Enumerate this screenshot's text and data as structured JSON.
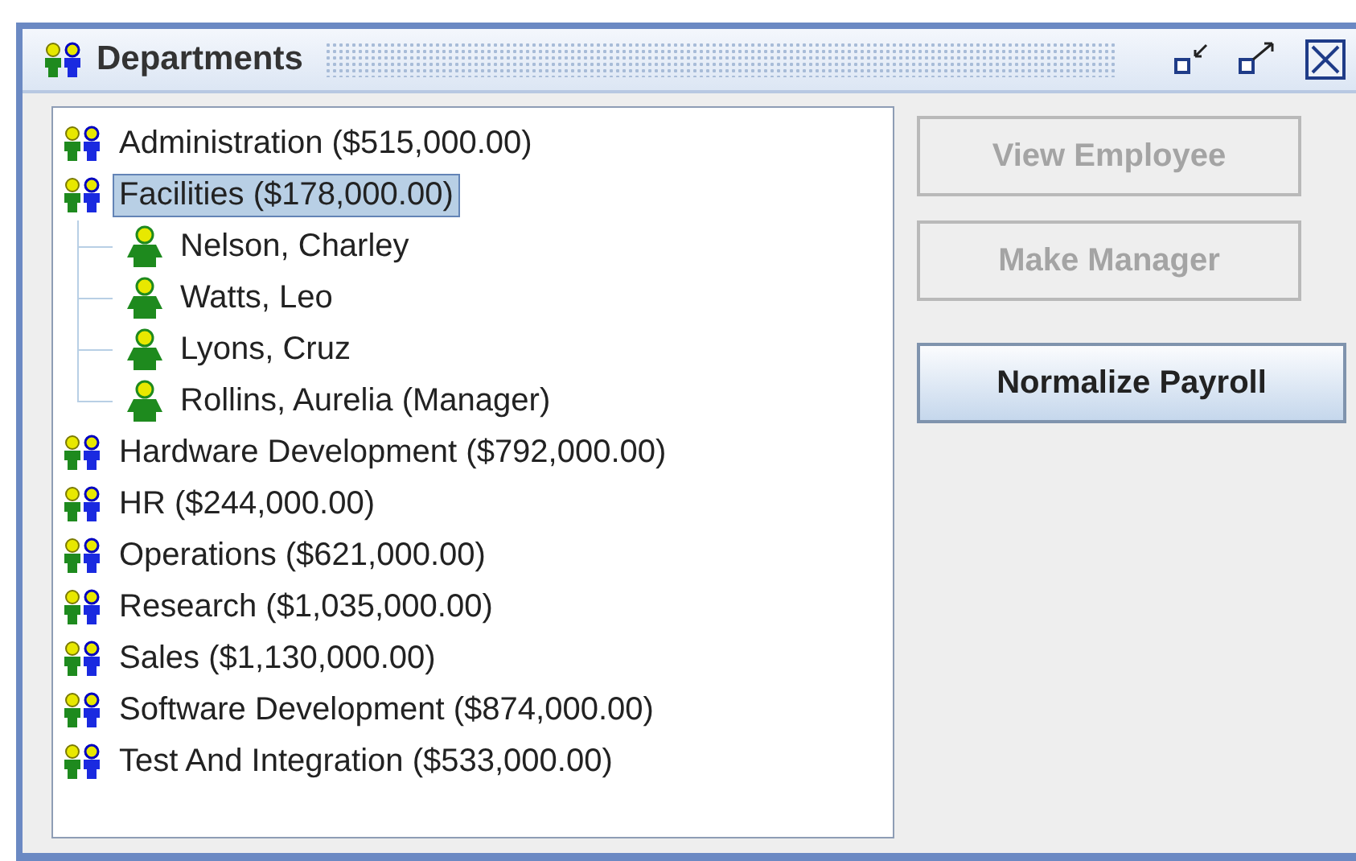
{
  "window": {
    "title": "Departments"
  },
  "tree": [
    {
      "label": "Administration ($515,000.00)",
      "kind": "department",
      "selected": false
    },
    {
      "label": "Facilities ($178,000.00)",
      "kind": "department",
      "selected": true,
      "children": [
        {
          "label": "Nelson, Charley",
          "kind": "employee",
          "selected": false
        },
        {
          "label": "Watts, Leo",
          "kind": "employee",
          "selected": false
        },
        {
          "label": "Lyons, Cruz",
          "kind": "employee",
          "selected": false
        },
        {
          "label": "Rollins, Aurelia (Manager)",
          "kind": "employee",
          "selected": false
        }
      ]
    },
    {
      "label": "Hardware Development ($792,000.00)",
      "kind": "department",
      "selected": false
    },
    {
      "label": "HR ($244,000.00)",
      "kind": "department",
      "selected": false
    },
    {
      "label": "Operations ($621,000.00)",
      "kind": "department",
      "selected": false
    },
    {
      "label": "Research ($1,035,000.00)",
      "kind": "department",
      "selected": false
    },
    {
      "label": "Sales ($1,130,000.00)",
      "kind": "department",
      "selected": false
    },
    {
      "label": "Software Development ($874,000.00)",
      "kind": "department",
      "selected": false
    },
    {
      "label": "Test And Integration ($533,000.00)",
      "kind": "department",
      "selected": false
    }
  ],
  "buttons": [
    {
      "label": "View Employee",
      "disabled": true
    },
    {
      "label": "Make Manager",
      "disabled": true
    },
    {
      "label": "Normalize Payroll",
      "disabled": false
    }
  ]
}
